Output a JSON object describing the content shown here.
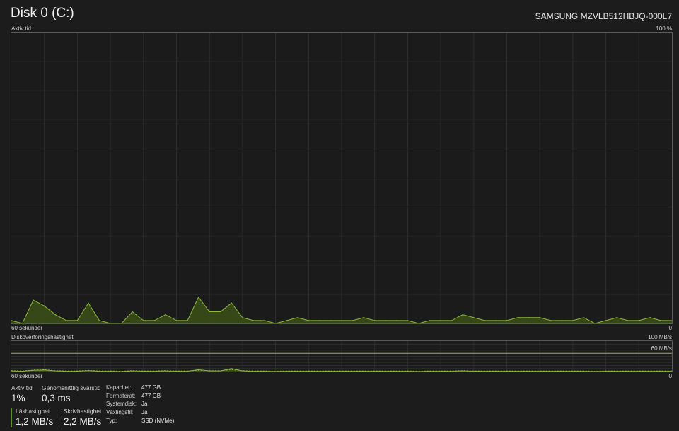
{
  "header": {
    "title": "Disk 0 (C:)",
    "model": "SAMSUNG MZVLB512HBJQ-000L7"
  },
  "active_chart": {
    "label": "Aktiv tid",
    "max_label": "100 %",
    "time_label": "60 sekunder",
    "min_label": "0"
  },
  "transfer_chart": {
    "label": "Diskoverföringshastighet",
    "max_label": "100 MB/s",
    "mid_label": "60 MB/s",
    "time_label": "60 sekunder",
    "min_label": "0"
  },
  "stats": {
    "active_time_label": "Aktiv tid",
    "active_time_value": "1%",
    "avg_response_label": "Genomsnittlig svarstid",
    "avg_response_value": "0,3 ms",
    "read_speed_label": "Läshastighet",
    "read_speed_value": "1,2 MB/s",
    "write_speed_label": "Skrivhastighet",
    "write_speed_value": "2,2 MB/s"
  },
  "properties": [
    {
      "label": "Kapacitet:",
      "value": "477 GB"
    },
    {
      "label": "Formaterat:",
      "value": "477 GB"
    },
    {
      "label": "Systemdisk:",
      "value": "Ja"
    },
    {
      "label": "Växlingsfil:",
      "value": "Ja"
    },
    {
      "label": "Typ:",
      "value": "SSD (NVMe)"
    }
  ],
  "colors": {
    "accent": "#8db83a",
    "fill": "#3a4d18",
    "grid": "#2e2e2e",
    "border": "#5a5a5a"
  },
  "chart_data": [
    {
      "type": "area",
      "title": "Aktiv tid",
      "xlabel": "60 sekunder",
      "ylim": [
        0,
        100
      ],
      "x": [
        60,
        59,
        58,
        57,
        56,
        55,
        54,
        53,
        52,
        51,
        50,
        49,
        48,
        47,
        46,
        45,
        44,
        43,
        42,
        41,
        40,
        39,
        38,
        37,
        36,
        35,
        34,
        33,
        32,
        31,
        30,
        29,
        28,
        27,
        26,
        25,
        24,
        23,
        22,
        21,
        20,
        19,
        18,
        17,
        16,
        15,
        14,
        13,
        12,
        11,
        10,
        9,
        8,
        7,
        6,
        5,
        4,
        3,
        2,
        1,
        0
      ],
      "series": [
        {
          "values": [
            1,
            0,
            8,
            6,
            3,
            1,
            1,
            7,
            1,
            0,
            0,
            4,
            1,
            1,
            3,
            1,
            1,
            9,
            4,
            4,
            7,
            2,
            1,
            1,
            0,
            1,
            2,
            1,
            1,
            1,
            1,
            1,
            2,
            1,
            1,
            1,
            1,
            0,
            1,
            1,
            1,
            3,
            2,
            1,
            1,
            1,
            2,
            2,
            2,
            1,
            1,
            1,
            2,
            0,
            1,
            2,
            1,
            1,
            2,
            1,
            1
          ]
        }
      ]
    },
    {
      "type": "line",
      "title": "Diskoverföringshastighet",
      "xlabel": "60 sekunder",
      "ylim": [
        0,
        100
      ],
      "reference_line": 60,
      "x": [
        60,
        59,
        58,
        57,
        56,
        55,
        54,
        53,
        52,
        51,
        50,
        49,
        48,
        47,
        46,
        45,
        44,
        43,
        42,
        41,
        40,
        39,
        38,
        37,
        36,
        35,
        34,
        33,
        32,
        31,
        30,
        29,
        28,
        27,
        26,
        25,
        24,
        23,
        22,
        21,
        20,
        19,
        18,
        17,
        16,
        15,
        14,
        13,
        12,
        11,
        10,
        9,
        8,
        7,
        6,
        5,
        4,
        3,
        2,
        1,
        0
      ],
      "series": [
        {
          "name": "Läshastighet",
          "values": [
            2,
            1,
            4,
            5,
            2,
            1,
            1,
            3,
            1,
            1,
            0,
            2,
            1,
            1,
            2,
            1,
            1,
            6,
            2,
            2,
            10,
            2,
            1,
            1,
            0,
            1,
            1,
            1,
            1,
            1,
            1,
            1,
            1,
            1,
            1,
            1,
            1,
            0,
            1,
            1,
            1,
            2,
            1,
            1,
            1,
            1,
            1,
            1,
            1,
            1,
            1,
            1,
            1,
            0,
            1,
            1,
            1,
            1,
            1,
            1,
            1
          ]
        },
        {
          "name": "Skrivhastighet",
          "values": [
            3,
            2,
            5,
            6,
            3,
            2,
            2,
            4,
            2,
            2,
            1,
            3,
            2,
            2,
            3,
            2,
            2,
            4,
            3,
            3,
            6,
            3,
            2,
            2,
            1,
            2,
            2,
            2,
            2,
            2,
            2,
            2,
            2,
            2,
            2,
            2,
            2,
            1,
            2,
            2,
            2,
            3,
            2,
            2,
            2,
            2,
            2,
            2,
            2,
            2,
            2,
            2,
            2,
            1,
            2,
            2,
            2,
            2,
            2,
            2,
            2
          ]
        }
      ]
    }
  ]
}
